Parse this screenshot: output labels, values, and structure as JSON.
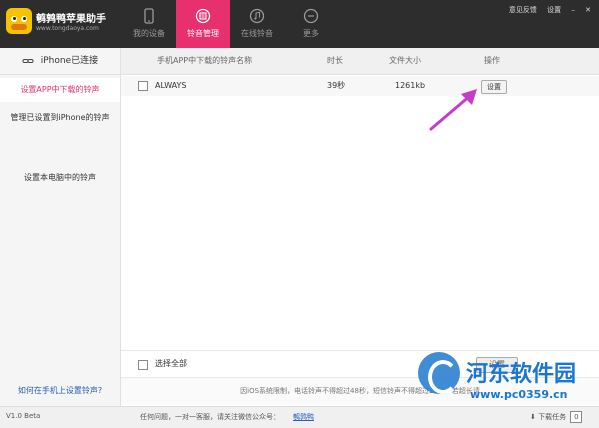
{
  "app": {
    "title": "鹌鹑鸭苹果助手",
    "url": "www.tongdaoya.com"
  },
  "nav": {
    "tabs": [
      {
        "label": "我的设备",
        "icon": "phone-icon"
      },
      {
        "label": "铃音管理",
        "icon": "ringtone-icon"
      },
      {
        "label": "在线铃音",
        "icon": "music-icon"
      },
      {
        "label": "更多",
        "icon": "more-icon"
      }
    ],
    "active_index": 1
  },
  "window": {
    "feedback": "意见反馈",
    "settings": "设置"
  },
  "sidebar": {
    "connection": "iPhone已连接",
    "items": [
      "设置APP中下载的铃声",
      "管理已设置到iPhone的铃声",
      "设置本电脑中的铃声"
    ],
    "help_link": "如何在手机上设置铃声?"
  },
  "table": {
    "headers": [
      "手机APP中下载的铃声名称",
      "时长",
      "文件大小",
      "操作"
    ],
    "rows": [
      {
        "name": "ALWAYS",
        "duration": "39秒",
        "size": "1261kb",
        "action": "设置"
      }
    ]
  },
  "footer": {
    "select_all": "选择全部",
    "bulk_button": "设置",
    "notice": "因iOS系统限制，电话铃声不得超过48秒，短信铃声不得超过25秒，若超长请"
  },
  "status": {
    "version": "V1.0 Beta",
    "help_text": "任何问题，一对一客服，请关注微信公众号：",
    "help_link": "鹌鹑鸭",
    "downloads_label": "下载任务",
    "downloads_count": "0"
  },
  "watermark": {
    "title": "河东软件园",
    "url": "www.pc0359.cn"
  },
  "colors": {
    "accent": "#e8306f",
    "topbar": "#2d2d2d",
    "link": "#2a5bb5",
    "watermark": "#1a76d2"
  }
}
